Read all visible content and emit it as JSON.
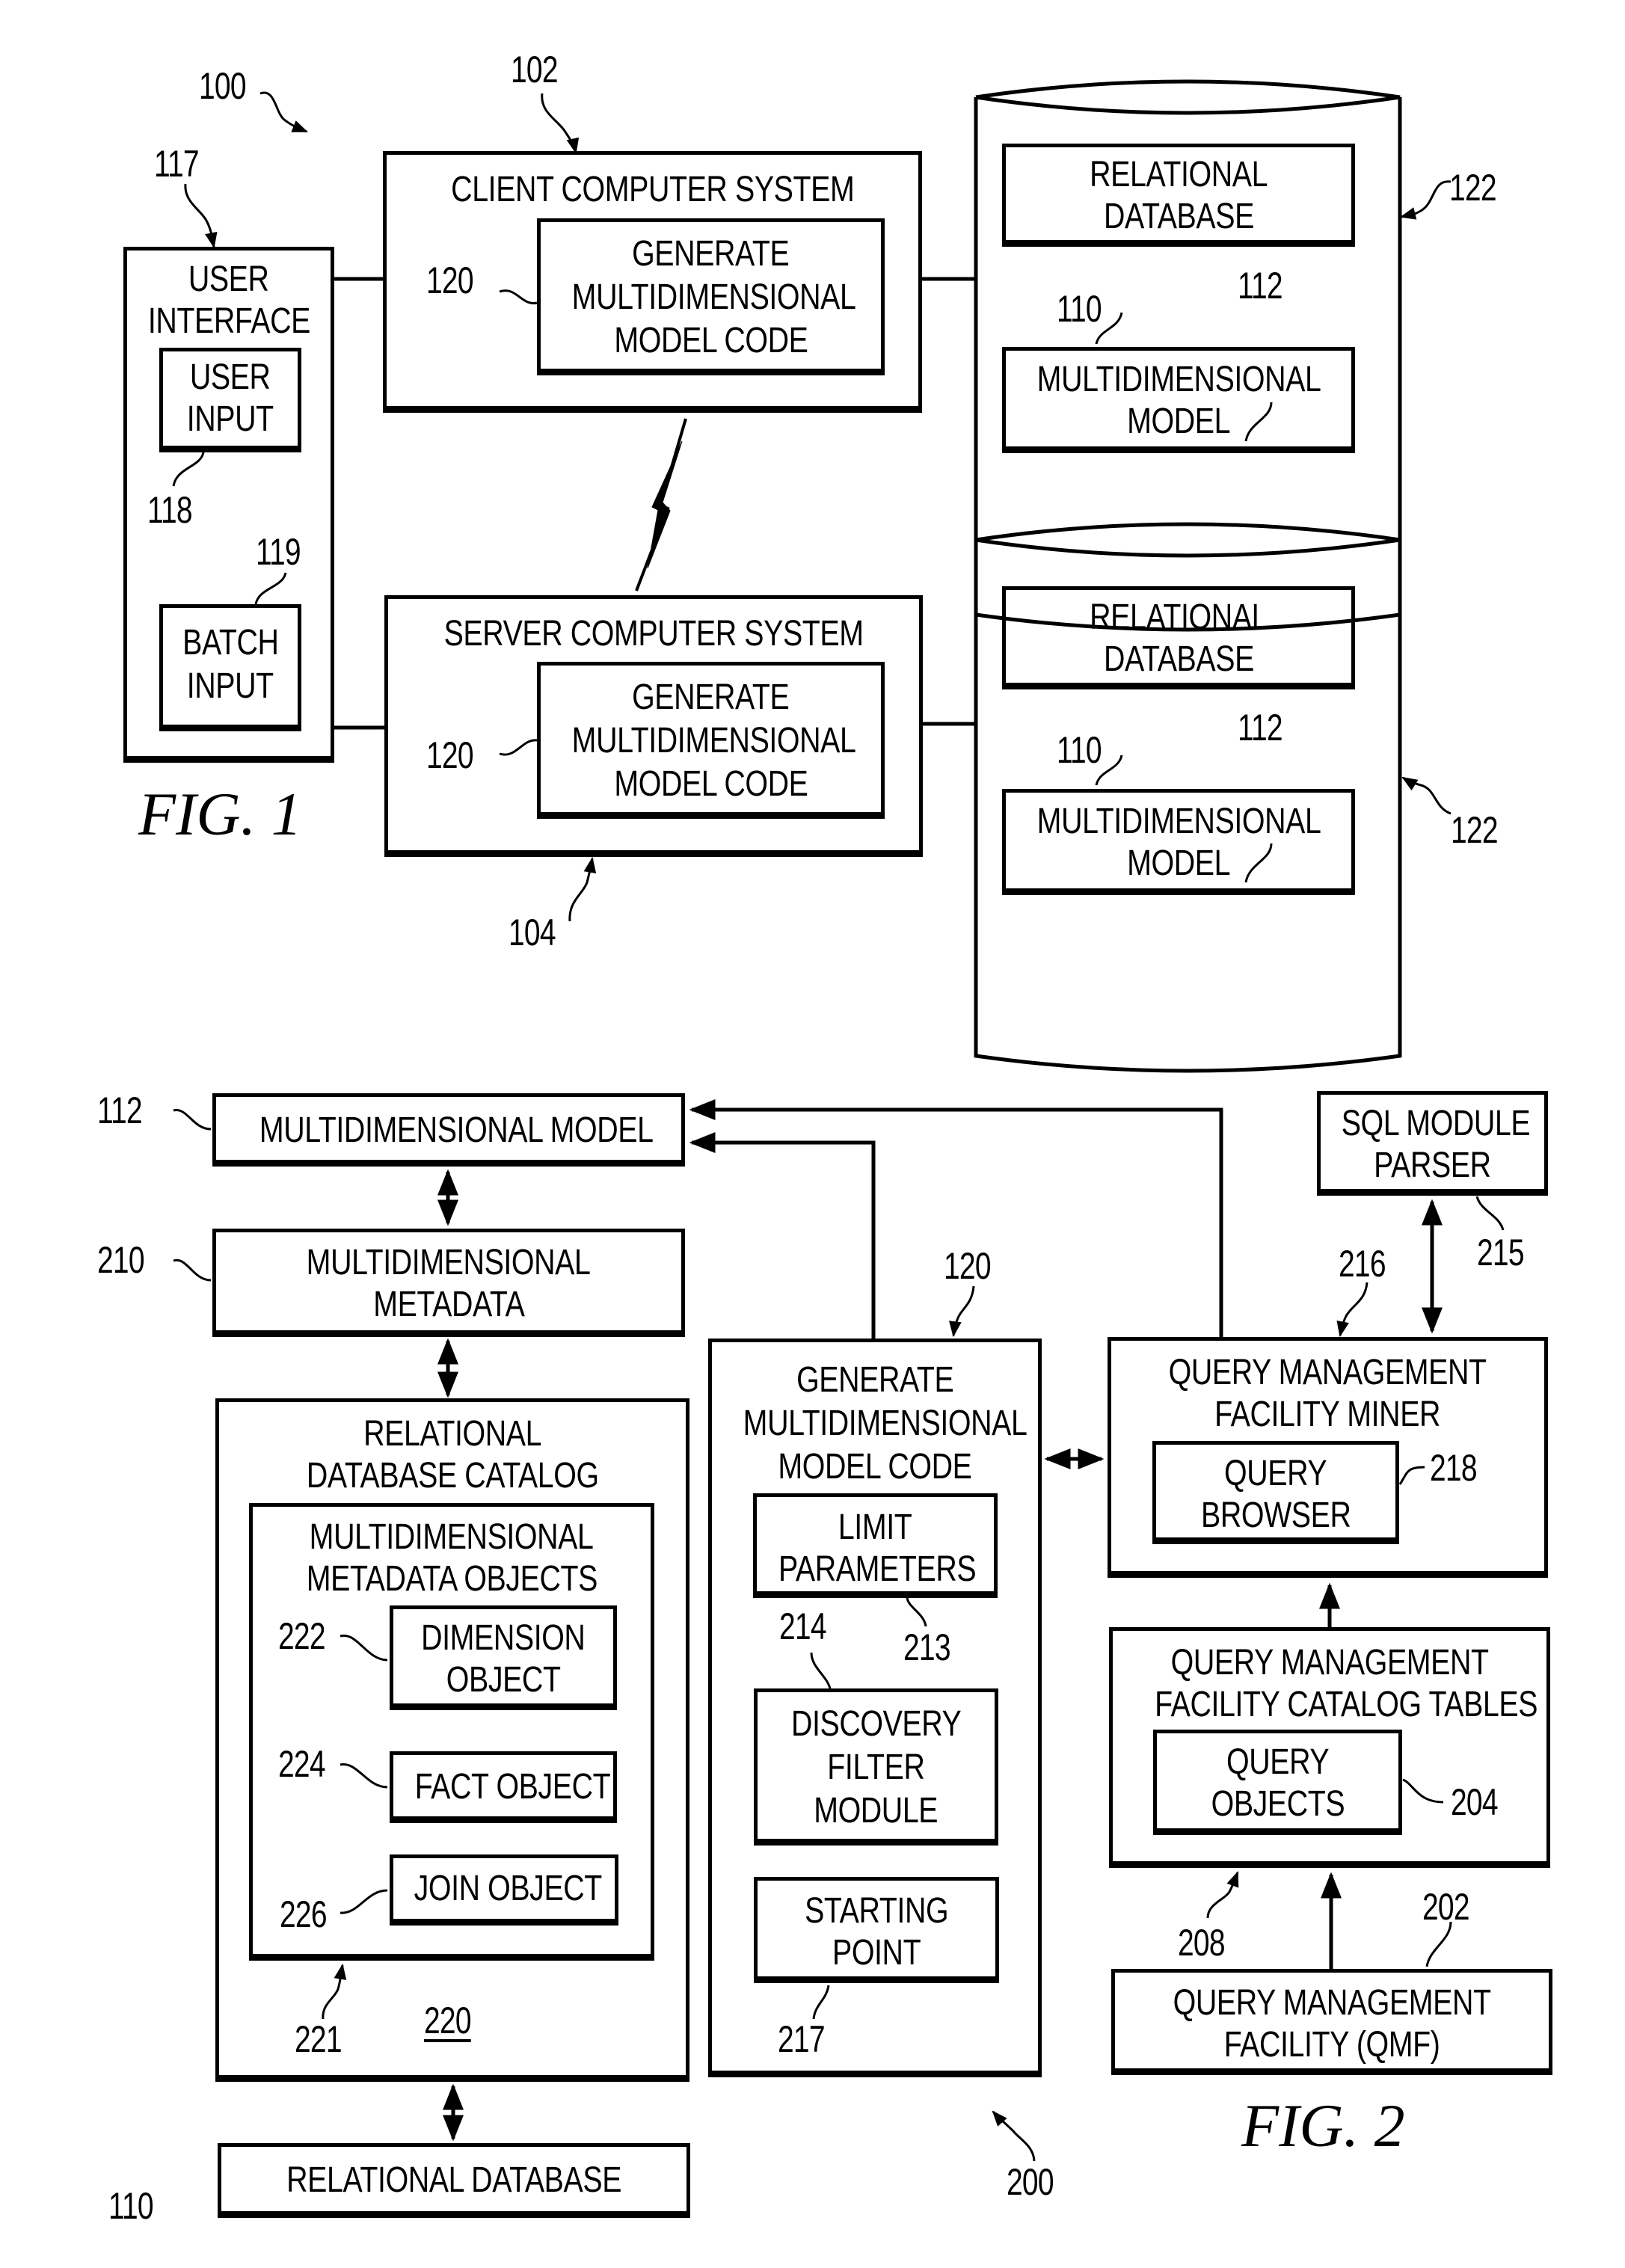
{
  "fig1": {
    "caption": "FIG. 1",
    "ref_system": "100",
    "user_interface": {
      "ref": "117",
      "title_line1": "USER",
      "title_line2": "INTERFACE",
      "user_input": {
        "ref": "118",
        "line1": "USER",
        "line2": "INPUT"
      },
      "batch_input": {
        "ref": "119",
        "line1": "BATCH",
        "line2": "INPUT"
      }
    },
    "client": {
      "ref": "102",
      "title": "CLIENT COMPUTER SYSTEM",
      "code": {
        "ref": "120",
        "line1": "GENERATE",
        "line2": "MULTIDIMENSIONAL",
        "line3": "MODEL CODE"
      }
    },
    "server": {
      "ref": "104",
      "title": "SERVER COMPUTER SYSTEM",
      "code": {
        "ref": "120",
        "line1": "GENERATE",
        "line2": "MULTIDIMENSIONAL",
        "line3": "MODEL CODE"
      }
    },
    "storage_top": {
      "ref": "122",
      "relational_db": {
        "ref": "110",
        "line1": "RELATIONAL",
        "line2": "DATABASE"
      },
      "md_model": {
        "ref": "112",
        "line1": "MULTIDIMENSIONAL",
        "line2": "MODEL"
      }
    },
    "storage_bottom": {
      "ref": "122",
      "relational_db": {
        "ref": "110",
        "line1": "RELATIONAL",
        "line2": "DATABASE"
      },
      "md_model": {
        "ref": "112",
        "line1": "MULTIDIMENSIONAL",
        "line2": "MODEL"
      }
    }
  },
  "fig2": {
    "caption": "FIG. 2",
    "ref_system": "200",
    "md_model": {
      "ref": "112",
      "label": "MULTIDIMENSIONAL MODEL"
    },
    "md_metadata": {
      "ref": "210",
      "line1": "MULTIDIMENSIONAL",
      "line2": "METADATA"
    },
    "rdb_catalog": {
      "ref": "220",
      "line1": "RELATIONAL",
      "line2": "DATABASE CATALOG",
      "md_objects": {
        "ref": "221",
        "line1": "MULTIDIMENSIONAL",
        "line2": "METADATA OBJECTS",
        "dimension": {
          "ref": "222",
          "line1": "DIMENSION",
          "line2": "OBJECT"
        },
        "fact": {
          "ref": "224",
          "label": "FACT OBJECT"
        },
        "join": {
          "ref": "226",
          "label": "JOIN OBJECT"
        }
      }
    },
    "relational_db": {
      "ref": "110",
      "label": "RELATIONAL DATABASE"
    },
    "gen_code": {
      "ref": "120",
      "line1": "GENERATE",
      "line2": "MULTIDIMENSIONAL",
      "line3": "MODEL CODE",
      "limit": {
        "ref": "213",
        "line1": "LIMIT",
        "line2": "PARAMETERS"
      },
      "discovery": {
        "ref": "214",
        "line1": "DISCOVERY",
        "line2": "FILTER",
        "line3": "MODULE"
      },
      "starting": {
        "ref": "217",
        "line1": "STARTING",
        "line2": "POINT"
      }
    },
    "sql_parser": {
      "ref": "215",
      "line1": "SQL MODULE",
      "line2": "PARSER"
    },
    "qmf_miner": {
      "ref": "216",
      "line1": "QUERY MANAGEMENT",
      "line2": "FACILITY MINER",
      "browser": {
        "ref": "218",
        "line1": "QUERY",
        "line2": "BROWSER"
      }
    },
    "qmf_catalog": {
      "ref": "208",
      "line1": "QUERY MANAGEMENT",
      "line2": "FACILITY CATALOG TABLES",
      "objects": {
        "ref": "204",
        "line1": "QUERY",
        "line2": "OBJECTS"
      }
    },
    "qmf": {
      "ref": "202",
      "line1": "QUERY MANAGEMENT",
      "line2": "FACILITY (QMF)"
    }
  }
}
